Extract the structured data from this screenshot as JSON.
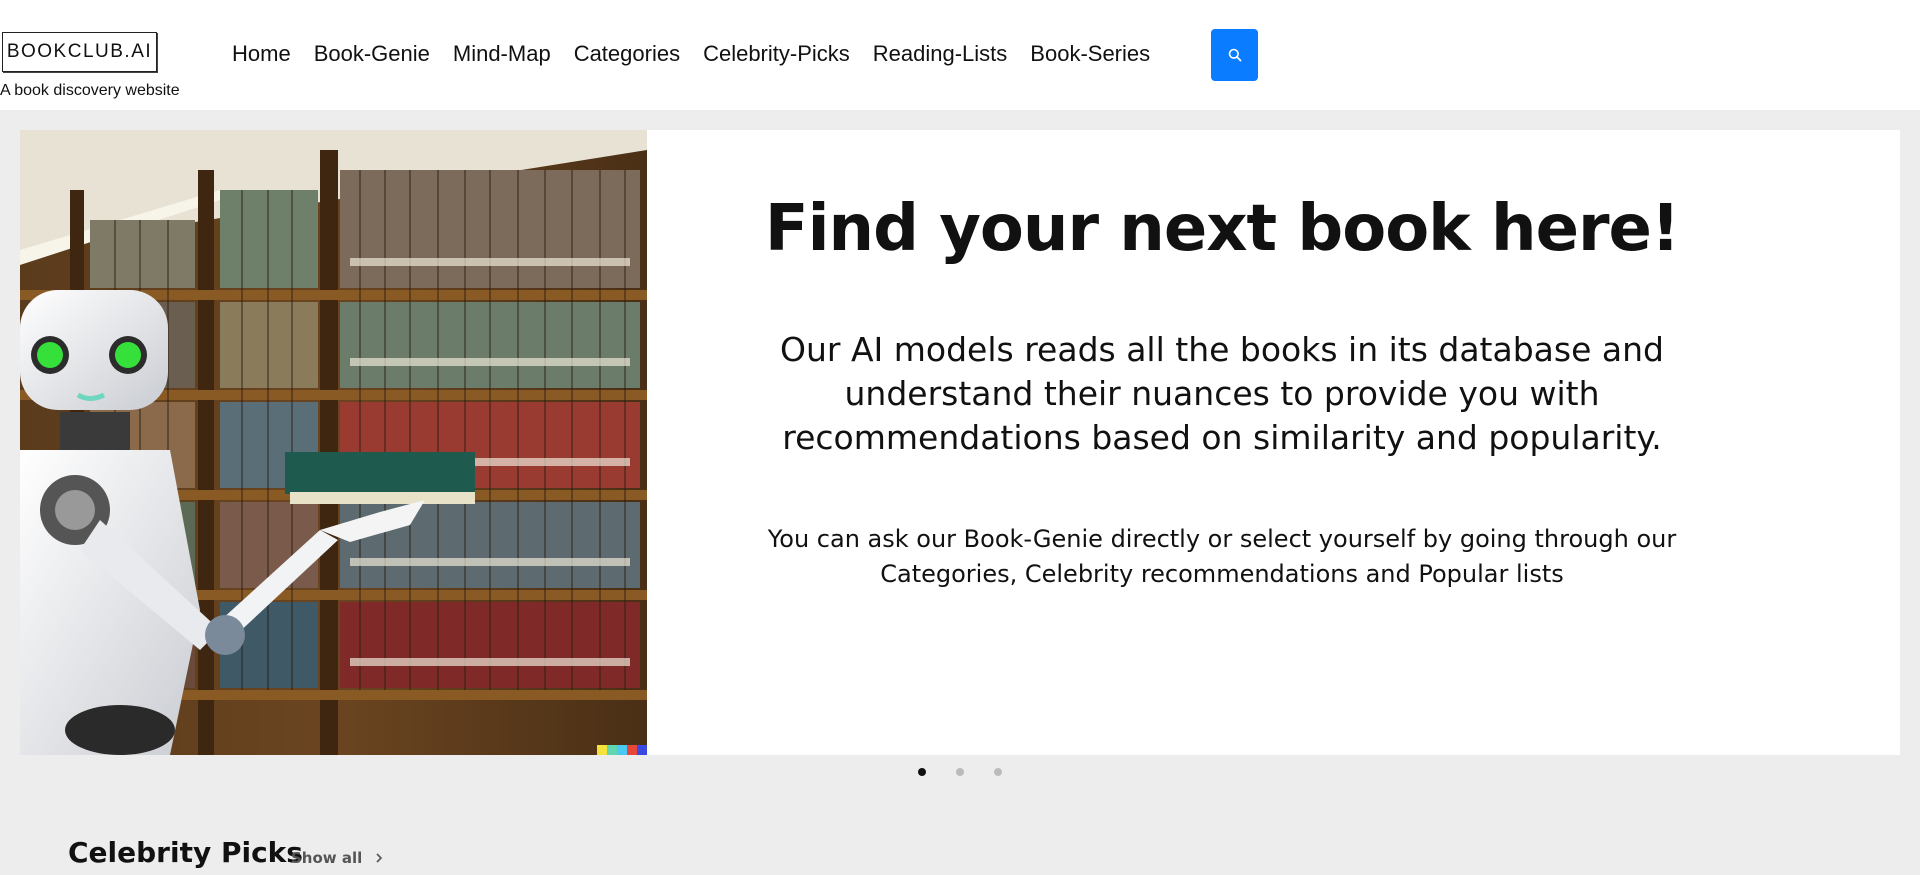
{
  "header": {
    "logo_text": "BOOKCLUB.AI",
    "tagline": "A book discovery website",
    "nav": [
      "Home",
      "Book-Genie",
      "Mind-Map",
      "Categories",
      "Celebrity-Picks",
      "Reading-Lists",
      "Book-Series"
    ],
    "search_icon": "search-icon",
    "accent_color": "#0a7cff"
  },
  "hero": {
    "title": "Find your next book here!",
    "paragraph1": "Our AI models reads all the books in its database and understand their nuances to provide you with recommendations based on similarity and popularity.",
    "paragraph2": "You can ask our Book-Genie directly or select yourself by going through our Categories, Celebrity recommendations and Popular lists",
    "carousel": {
      "slides": 3,
      "active_index": 0
    }
  },
  "section": {
    "title": "Celebrity Picks",
    "show_all_label": "Show all",
    "show_all_icon": "chevron-right-icon"
  }
}
